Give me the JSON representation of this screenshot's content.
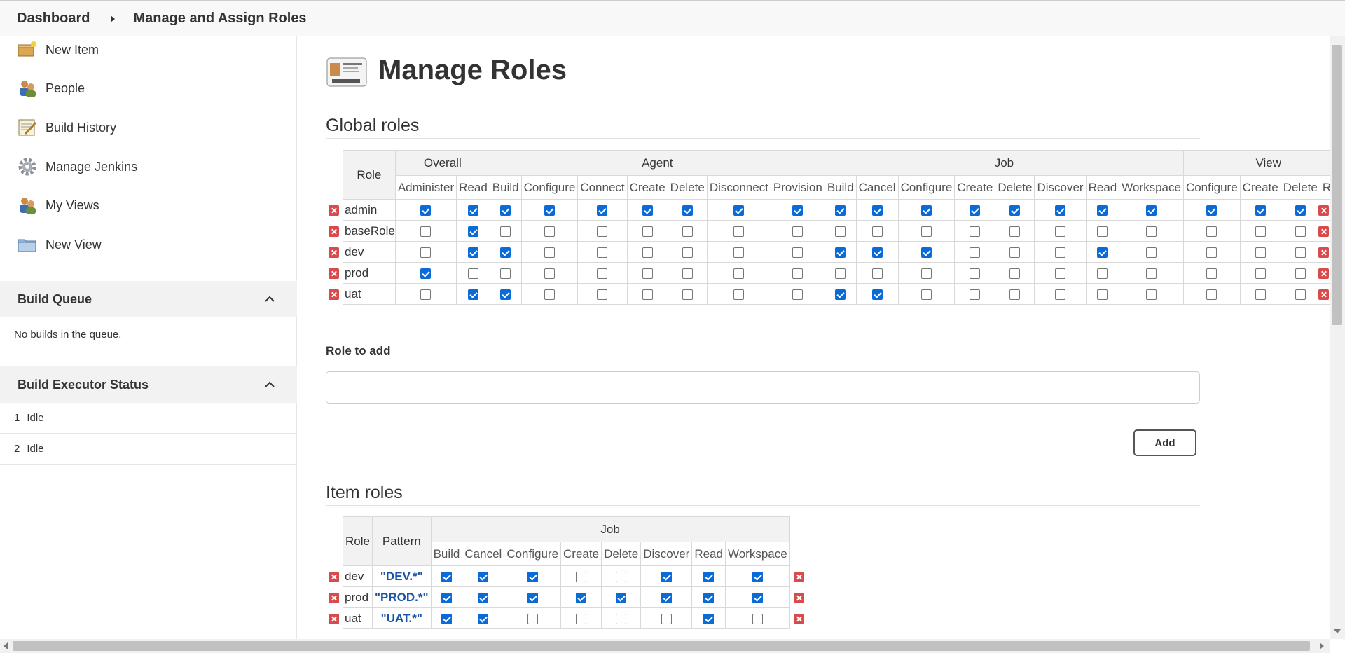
{
  "breadcrumb": {
    "dashboard": "Dashboard",
    "current": "Manage and Assign Roles"
  },
  "sidebar": {
    "tasks": [
      {
        "label": "New Item",
        "icon": "new-item-icon"
      },
      {
        "label": "People",
        "icon": "people-icon"
      },
      {
        "label": "Build History",
        "icon": "notepad-icon"
      },
      {
        "label": "Manage Jenkins",
        "icon": "gear-icon"
      },
      {
        "label": "My Views",
        "icon": "people-icon"
      },
      {
        "label": "New View",
        "icon": "folder-icon"
      }
    ],
    "build_queue": {
      "title": "Build Queue",
      "empty": "No builds in the queue."
    },
    "executors": {
      "title": "Build Executor Status",
      "rows": [
        {
          "num": "1",
          "status": "Idle"
        },
        {
          "num": "2",
          "status": "Idle"
        }
      ]
    }
  },
  "main": {
    "title": "Manage Roles",
    "global": {
      "heading": "Global roles",
      "role_col": "Role",
      "groups": [
        {
          "name": "Overall",
          "perms": [
            "Administer",
            "Read"
          ]
        },
        {
          "name": "Agent",
          "perms": [
            "Build",
            "Configure",
            "Connect",
            "Create",
            "Delete",
            "Disconnect",
            "Provision"
          ]
        },
        {
          "name": "Job",
          "perms": [
            "Build",
            "Cancel",
            "Configure",
            "Create",
            "Delete",
            "Discover",
            "Read",
            "Workspace"
          ]
        },
        {
          "name": "View",
          "perms": [
            "Configure",
            "Create",
            "Delete",
            "Read"
          ]
        }
      ],
      "rows": [
        {
          "role": "admin",
          "checks": [
            1,
            1,
            1,
            1,
            1,
            1,
            1,
            1,
            1,
            1,
            1,
            1,
            1,
            1,
            1,
            1,
            1,
            1,
            1,
            1,
            1
          ]
        },
        {
          "role": "baseRole",
          "checks": [
            0,
            1,
            0,
            0,
            0,
            0,
            0,
            0,
            0,
            0,
            0,
            0,
            0,
            0,
            0,
            0,
            0,
            0,
            0,
            0,
            0
          ]
        },
        {
          "role": "dev",
          "checks": [
            0,
            1,
            1,
            0,
            0,
            0,
            0,
            0,
            0,
            1,
            1,
            1,
            0,
            0,
            0,
            1,
            0,
            0,
            0,
            0,
            0
          ]
        },
        {
          "role": "prod",
          "checks": [
            1,
            0,
            0,
            0,
            0,
            0,
            0,
            0,
            0,
            0,
            0,
            0,
            0,
            0,
            0,
            0,
            0,
            0,
            0,
            0,
            0
          ]
        },
        {
          "role": "uat",
          "checks": [
            0,
            1,
            1,
            0,
            0,
            0,
            0,
            0,
            0,
            1,
            1,
            0,
            0,
            0,
            0,
            0,
            0,
            0,
            0,
            0,
            0
          ]
        }
      ]
    },
    "role_to_add": {
      "label": "Role to add",
      "value": "",
      "button": "Add"
    },
    "item": {
      "heading": "Item roles",
      "role_col": "Role",
      "pattern_col": "Pattern",
      "group": "Job",
      "perms": [
        "Build",
        "Cancel",
        "Configure",
        "Create",
        "Delete",
        "Discover",
        "Read",
        "Workspace"
      ],
      "rows": [
        {
          "role": "dev",
          "pattern": "\"DEV.*\"",
          "checks": [
            1,
            1,
            1,
            0,
            0,
            1,
            1,
            1
          ]
        },
        {
          "role": "prod",
          "pattern": "\"PROD.*\"",
          "checks": [
            1,
            1,
            1,
            1,
            1,
            1,
            1,
            1
          ]
        },
        {
          "role": "uat",
          "pattern": "\"UAT.*\"",
          "checks": [
            1,
            1,
            0,
            0,
            0,
            0,
            1,
            0
          ]
        }
      ]
    }
  },
  "colors": {
    "checkbox": "#0b6bd6",
    "pattern_text": "#1a54a6",
    "delete": "#d94a4a"
  }
}
